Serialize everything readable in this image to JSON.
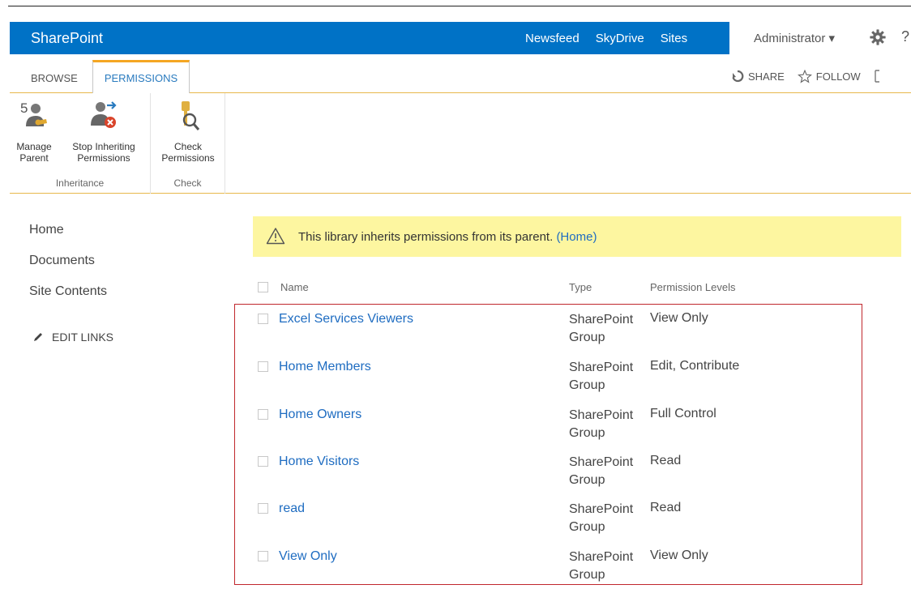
{
  "suitebar": {
    "brand": "SharePoint",
    "links": [
      "Newsfeed",
      "SkyDrive",
      "Sites"
    ],
    "user": "Administrator ▾",
    "help": "?"
  },
  "ribbon_tabs": {
    "browse": "BROWSE",
    "permissions": "PERMISSIONS",
    "share": "SHARE",
    "follow": "FOLLOW"
  },
  "ribbon": {
    "manage_parent": [
      "Manage",
      "Parent"
    ],
    "stop_inheriting": [
      "Stop Inheriting",
      "Permissions"
    ],
    "check_permissions": [
      "Check",
      "Permissions"
    ],
    "group_inheritance": "Inheritance",
    "group_check": "Check"
  },
  "leftnav": {
    "items": [
      "Home",
      "Documents",
      "Site Contents"
    ],
    "edit_links": "EDIT LINKS"
  },
  "banner": {
    "message": "This library inherits permissions from its parent.",
    "link": "(Home)"
  },
  "table": {
    "headers": {
      "name": "Name",
      "type": "Type",
      "permission": "Permission Levels"
    },
    "rows": [
      {
        "name": "Excel Services Viewers",
        "type_line1": "SharePoint",
        "type_line2": "Group",
        "permission": "View Only"
      },
      {
        "name": "Home Members",
        "type_line1": "SharePoint",
        "type_line2": "Group",
        "permission": "Edit, Contribute"
      },
      {
        "name": "Home Owners",
        "type_line1": "SharePoint",
        "type_line2": "Group",
        "permission": "Full Control"
      },
      {
        "name": "Home Visitors",
        "type_line1": "SharePoint",
        "type_line2": "Group",
        "permission": "Read"
      },
      {
        "name": "read",
        "type_line1": "SharePoint",
        "type_line2": "Group",
        "permission": "Read"
      },
      {
        "name": "View Only",
        "type_line1": "SharePoint",
        "type_line2": "Group",
        "permission": "View Only"
      }
    ]
  },
  "colors": {
    "suite_blue": "#0072c6",
    "link_blue": "#1e6cc1",
    "tab_accent": "#f5a623",
    "banner_yellow": "#fdf6a0",
    "highlight_red": "#c0272d"
  }
}
